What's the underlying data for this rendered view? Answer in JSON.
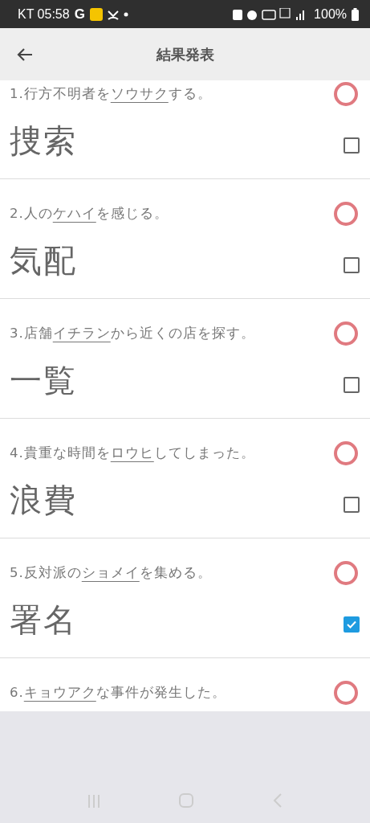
{
  "status_bar": {
    "carrier": "KT",
    "time": "05:58",
    "g_label": "G",
    "battery": "100%"
  },
  "header": {
    "title": "結果発表"
  },
  "questions": [
    {
      "number": "1.",
      "before": "行方不明者を",
      "underlined": "ソウサク",
      "after": "する。",
      "correct": true,
      "answer": "捜索",
      "checked": false
    },
    {
      "number": "2.",
      "before": "人の",
      "underlined": "ケハイ",
      "after": "を感じる。",
      "correct": true,
      "answer": "気配",
      "checked": false
    },
    {
      "number": "3.",
      "before": "店舗",
      "underlined": "イチラン",
      "after": "から近くの店を探す。",
      "correct": true,
      "answer": "一覧",
      "checked": false
    },
    {
      "number": "4.",
      "before": "貴重な時間を",
      "underlined": "ロウヒ",
      "after": "してしまった。",
      "correct": true,
      "answer": "浪費",
      "checked": false
    },
    {
      "number": "5.",
      "before": "反対派の",
      "underlined": "ショメイ",
      "after": "を集める。",
      "correct": true,
      "answer": "署名",
      "checked": true
    },
    {
      "number": "6.",
      "underlined": "キョウアク",
      "after": "な事件が発生した。",
      "correct": true
    }
  ]
}
